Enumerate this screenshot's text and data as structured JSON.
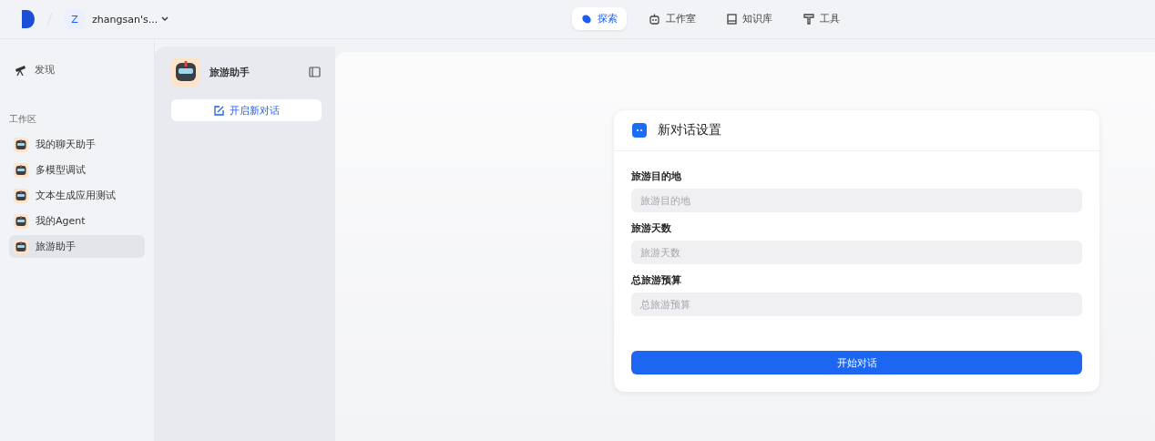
{
  "header": {
    "workspace_initial": "Z",
    "workspace_name": "zhangsan's...",
    "nav": [
      {
        "label": "探索",
        "kind": "explore",
        "selected": true
      },
      {
        "label": "工作室",
        "kind": "studio",
        "selected": false
      },
      {
        "label": "知识库",
        "kind": "knowledge",
        "selected": false
      },
      {
        "label": "工具",
        "kind": "tools",
        "selected": false
      }
    ]
  },
  "sidebar": {
    "discover": "发现",
    "section_title": "工作区",
    "items": [
      {
        "label": "我的聊天助手",
        "selected": false
      },
      {
        "label": "多模型调试",
        "selected": false
      },
      {
        "label": "文本生成应用测试",
        "selected": false
      },
      {
        "label": "我的Agent",
        "selected": false
      },
      {
        "label": "旅游助手",
        "selected": true
      }
    ]
  },
  "app_panel": {
    "app_name": "旅游助手",
    "new_chat_button": "开启新对话"
  },
  "settings_card": {
    "title": "新对话设置",
    "fields": [
      {
        "label": "旅游目的地",
        "placeholder": "旅游目的地"
      },
      {
        "label": "旅游天数",
        "placeholder": "旅游天数"
      },
      {
        "label": "总旅游预算",
        "placeholder": "总旅游预算"
      }
    ],
    "start_button": "开始对话"
  }
}
